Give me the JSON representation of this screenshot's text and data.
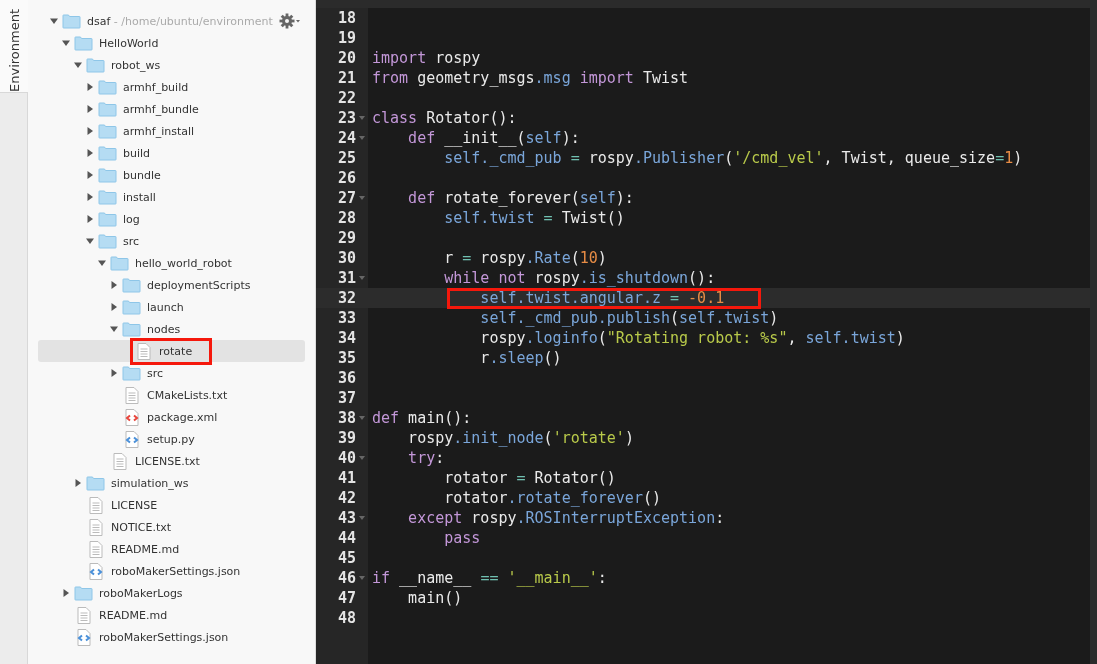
{
  "side_tab": {
    "label": "Environment",
    "selected": true
  },
  "tree": [
    {
      "kind": "folder",
      "label": "dsaf",
      "path": " - /home/ubuntu/environment",
      "expanded": true,
      "selected": false,
      "children": [
        {
          "kind": "folder",
          "label": "HelloWorld",
          "expanded": true,
          "selected": false,
          "children": [
            {
              "kind": "folder",
              "label": "robot_ws",
              "expanded": true,
              "selected": false,
              "children": [
                {
                  "kind": "folder",
                  "label": "armhf_build",
                  "expanded": false,
                  "selected": false
                },
                {
                  "kind": "folder",
                  "label": "armhf_bundle",
                  "expanded": false,
                  "selected": false
                },
                {
                  "kind": "folder",
                  "label": "armhf_install",
                  "expanded": false,
                  "selected": false
                },
                {
                  "kind": "folder",
                  "label": "build",
                  "expanded": false,
                  "selected": false
                },
                {
                  "kind": "folder",
                  "label": "bundle",
                  "expanded": false,
                  "selected": false
                },
                {
                  "kind": "folder",
                  "label": "install",
                  "expanded": false,
                  "selected": false
                },
                {
                  "kind": "folder",
                  "label": "log",
                  "expanded": false,
                  "selected": false
                },
                {
                  "kind": "folder",
                  "label": "src",
                  "expanded": true,
                  "selected": false,
                  "children": [
                    {
                      "kind": "folder",
                      "label": "hello_world_robot",
                      "expanded": true,
                      "selected": false,
                      "children": [
                        {
                          "kind": "folder",
                          "label": "deploymentScripts",
                          "expanded": false,
                          "selected": false
                        },
                        {
                          "kind": "folder",
                          "label": "launch",
                          "expanded": false,
                          "selected": false
                        },
                        {
                          "kind": "folder",
                          "label": "nodes",
                          "expanded": true,
                          "selected": false,
                          "children": [
                            {
                              "kind": "file",
                              "label": "rotate",
                              "selected": true,
                              "annotated": true
                            }
                          ]
                        },
                        {
                          "kind": "folder",
                          "label": "src",
                          "expanded": false,
                          "selected": false
                        },
                        {
                          "kind": "file",
                          "label": "CMakeLists.txt",
                          "selected": false
                        },
                        {
                          "kind": "xml",
                          "label": "package.xml",
                          "selected": false
                        },
                        {
                          "kind": "code",
                          "label": "setup.py",
                          "selected": false
                        }
                      ]
                    },
                    {
                      "kind": "file",
                      "label": "LICENSE.txt",
                      "selected": false
                    }
                  ]
                }
              ]
            },
            {
              "kind": "folder",
              "label": "simulation_ws",
              "expanded": false,
              "selected": false
            },
            {
              "kind": "file",
              "label": "LICENSE",
              "selected": false
            },
            {
              "kind": "file",
              "label": "NOTICE.txt",
              "selected": false
            },
            {
              "kind": "file",
              "label": "README.md",
              "selected": false
            },
            {
              "kind": "code",
              "label": "roboMakerSettings.json",
              "selected": false
            }
          ]
        },
        {
          "kind": "folder",
          "label": "roboMakerLogs",
          "expanded": false,
          "selected": false
        },
        {
          "kind": "file",
          "label": "README.md",
          "selected": false
        },
        {
          "kind": "code",
          "label": "roboMakerSettings.json",
          "selected": false
        }
      ]
    }
  ],
  "editor": {
    "lines": [
      {
        "number": "18"
      },
      {
        "number": "19"
      },
      {
        "number": "20",
        "tokens": [
          {
            "kind": "keyword",
            "text": "import"
          },
          {
            "kind": "plain",
            "text": " rospy"
          }
        ]
      },
      {
        "number": "21",
        "tokens": [
          {
            "kind": "keyword",
            "text": "from"
          },
          {
            "kind": "plain",
            "text": " geometry_msgs"
          },
          {
            "kind": "name",
            "text": ".msg"
          },
          {
            "kind": "keyword",
            "text": " import"
          },
          {
            "kind": "plain",
            "text": " Twist"
          }
        ]
      },
      {
        "number": "22"
      },
      {
        "number": "23",
        "fold": true,
        "tokens": [
          {
            "kind": "keyword",
            "text": "class"
          },
          {
            "kind": "plain",
            "text": " Rotator():"
          }
        ]
      },
      {
        "number": "24",
        "fold": true,
        "tokens": [
          {
            "kind": "keyword",
            "text": "    def"
          },
          {
            "kind": "plain",
            "text": " __init__("
          },
          {
            "kind": "name",
            "text": "self"
          },
          {
            "kind": "plain",
            "text": "):"
          }
        ]
      },
      {
        "number": "25",
        "tokens": [
          {
            "kind": "name",
            "text": "        self._cmd_pub"
          },
          {
            "kind": "operator",
            "text": " ="
          },
          {
            "kind": "plain",
            "text": " rospy"
          },
          {
            "kind": "name",
            "text": ".Publisher"
          },
          {
            "kind": "plain",
            "text": "("
          },
          {
            "kind": "string",
            "text": "'/cmd_vel'"
          },
          {
            "kind": "plain",
            "text": ", Twist, queue_size"
          },
          {
            "kind": "operator",
            "text": "="
          },
          {
            "kind": "number",
            "text": "1"
          },
          {
            "kind": "plain",
            "text": ")"
          }
        ]
      },
      {
        "number": "26"
      },
      {
        "number": "27",
        "fold": true,
        "tokens": [
          {
            "kind": "keyword",
            "text": "    def"
          },
          {
            "kind": "plain",
            "text": " rotate_forever("
          },
          {
            "kind": "name",
            "text": "self"
          },
          {
            "kind": "plain",
            "text": "):"
          }
        ]
      },
      {
        "number": "28",
        "tokens": [
          {
            "kind": "name",
            "text": "        self.twist"
          },
          {
            "kind": "operator",
            "text": " ="
          },
          {
            "kind": "plain",
            "text": " Twist()"
          }
        ]
      },
      {
        "number": "29"
      },
      {
        "number": "30",
        "tokens": [
          {
            "kind": "plain",
            "text": "        r"
          },
          {
            "kind": "operator",
            "text": " ="
          },
          {
            "kind": "plain",
            "text": " rospy"
          },
          {
            "kind": "name",
            "text": ".Rate"
          },
          {
            "kind": "plain",
            "text": "("
          },
          {
            "kind": "number",
            "text": "10"
          },
          {
            "kind": "plain",
            "text": ")"
          }
        ]
      },
      {
        "number": "31",
        "fold": true,
        "tokens": [
          {
            "kind": "keyword",
            "text": "        while not"
          },
          {
            "kind": "plain",
            "text": " rospy"
          },
          {
            "kind": "name",
            "text": ".is_shutdown"
          },
          {
            "kind": "plain",
            "text": "():"
          }
        ]
      },
      {
        "number": "32",
        "active": true,
        "annotated": true,
        "tokens": [
          {
            "kind": "name",
            "text": "            self.twist.angular.z"
          },
          {
            "kind": "operator",
            "text": " ="
          },
          {
            "kind": "number",
            "text": " -0.1"
          }
        ]
      },
      {
        "number": "33",
        "tokens": [
          {
            "kind": "name",
            "text": "            self._cmd_pub.publish"
          },
          {
            "kind": "plain",
            "text": "("
          },
          {
            "kind": "name",
            "text": "self.twist"
          },
          {
            "kind": "plain",
            "text": ")"
          }
        ]
      },
      {
        "number": "34",
        "tokens": [
          {
            "kind": "plain",
            "text": "            rospy"
          },
          {
            "kind": "name",
            "text": ".loginfo"
          },
          {
            "kind": "plain",
            "text": "("
          },
          {
            "kind": "string",
            "text": "\"Rotating robot: %s\""
          },
          {
            "kind": "plain",
            "text": ", "
          },
          {
            "kind": "name",
            "text": "self.twist"
          },
          {
            "kind": "plain",
            "text": ")"
          }
        ]
      },
      {
        "number": "35",
        "tokens": [
          {
            "kind": "plain",
            "text": "            r"
          },
          {
            "kind": "name",
            "text": ".sleep"
          },
          {
            "kind": "plain",
            "text": "()"
          }
        ]
      },
      {
        "number": "36"
      },
      {
        "number": "37"
      },
      {
        "number": "38",
        "fold": true,
        "tokens": [
          {
            "kind": "keyword",
            "text": "def"
          },
          {
            "kind": "plain",
            "text": " main():"
          }
        ]
      },
      {
        "number": "39",
        "tokens": [
          {
            "kind": "plain",
            "text": "    rospy"
          },
          {
            "kind": "name",
            "text": ".init_node"
          },
          {
            "kind": "plain",
            "text": "("
          },
          {
            "kind": "string",
            "text": "'rotate'"
          },
          {
            "kind": "plain",
            "text": ")"
          }
        ]
      },
      {
        "number": "40",
        "fold": true,
        "tokens": [
          {
            "kind": "keyword",
            "text": "    try"
          },
          {
            "kind": "plain",
            "text": ":"
          }
        ]
      },
      {
        "number": "41",
        "tokens": [
          {
            "kind": "plain",
            "text": "        rotator"
          },
          {
            "kind": "operator",
            "text": " ="
          },
          {
            "kind": "plain",
            "text": " Rotator()"
          }
        ]
      },
      {
        "number": "42",
        "tokens": [
          {
            "kind": "plain",
            "text": "        rotator"
          },
          {
            "kind": "name",
            "text": ".rotate_forever"
          },
          {
            "kind": "plain",
            "text": "()"
          }
        ]
      },
      {
        "number": "43",
        "fold": true,
        "tokens": [
          {
            "kind": "keyword",
            "text": "    except"
          },
          {
            "kind": "plain",
            "text": " rospy"
          },
          {
            "kind": "name",
            "text": ".ROSInterruptException"
          },
          {
            "kind": "plain",
            "text": ":"
          }
        ]
      },
      {
        "number": "44",
        "tokens": [
          {
            "kind": "keyword",
            "text": "        pass"
          }
        ]
      },
      {
        "number": "45"
      },
      {
        "number": "46",
        "fold": true,
        "tokens": [
          {
            "kind": "keyword",
            "text": "if"
          },
          {
            "kind": "plain",
            "text": " __name__ "
          },
          {
            "kind": "operator",
            "text": "=="
          },
          {
            "kind": "string",
            "text": " '__main__'"
          },
          {
            "kind": "plain",
            "text": ":"
          }
        ]
      },
      {
        "number": "47",
        "tokens": [
          {
            "kind": "plain",
            "text": "    main()"
          }
        ]
      },
      {
        "number": "48"
      }
    ]
  }
}
